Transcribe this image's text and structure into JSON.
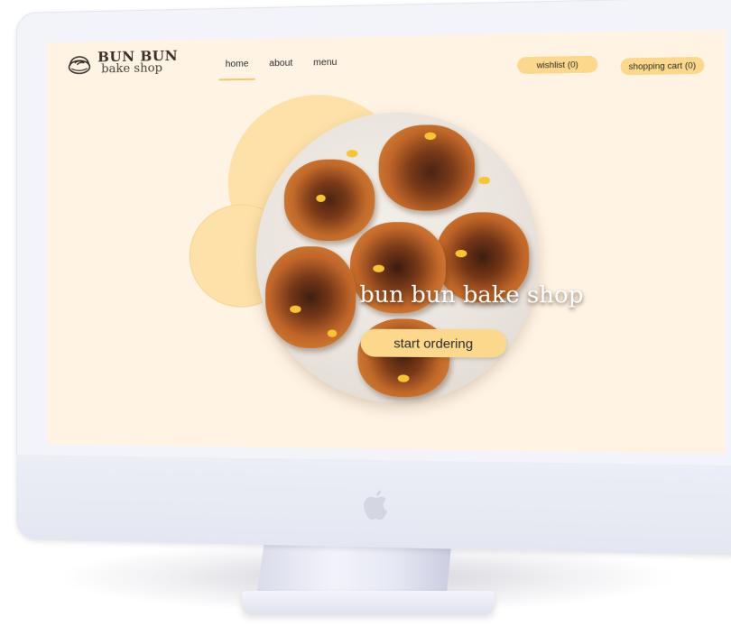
{
  "brand": {
    "title": "BUN BUN",
    "subtitle": "bake shop",
    "logo_icon": "cinnamon-bun-icon"
  },
  "nav": {
    "items": [
      {
        "label": "home",
        "active": true
      },
      {
        "label": "about",
        "active": false
      },
      {
        "label": "menu",
        "active": false
      }
    ]
  },
  "header_actions": {
    "wishlist_label": "wishlist (0)",
    "cart_label": "shopping cart (0)"
  },
  "hero": {
    "title": "bun bun bake shop",
    "cta_label": "start ordering"
  },
  "device": {
    "logo_icon": "apple-icon"
  },
  "colors": {
    "page_background": "#fff3e4",
    "accent_yellow": "#fbd88c",
    "blob_yellow": "#fde1a8",
    "text_dark": "#2b2b2b"
  }
}
